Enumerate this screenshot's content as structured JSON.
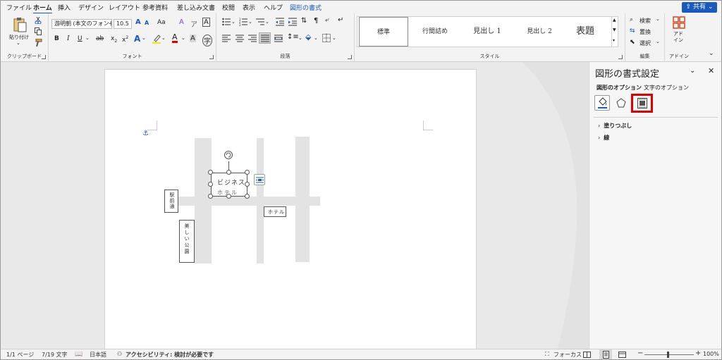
{
  "menu": {
    "tabs": [
      "ファイル",
      "ホーム",
      "挿入",
      "デザイン",
      "レイアウト",
      "参考資料",
      "差し込み文書",
      "校閲",
      "表示",
      "ヘルプ",
      "図形の書式"
    ],
    "share_label": "共有"
  },
  "ribbon": {
    "clipboard": {
      "paste_label": "貼り付け",
      "group_label": "クリップボード"
    },
    "font": {
      "font_name": "游明朝 (本文のフォント",
      "font_size": "10.5",
      "aa_label": "Aa",
      "group_label": "フォント"
    },
    "paragraph": {
      "group_label": "段落"
    },
    "styles": {
      "items": [
        "標準",
        "行間詰め",
        "見出し 1",
        "見出し 2",
        "表題"
      ],
      "group_label": "スタイル"
    },
    "editing": {
      "find": "検索",
      "replace": "置換",
      "select": "選択",
      "group_label": "編集"
    },
    "addins": {
      "label": "アド\nイン",
      "group_label": "アドイン"
    }
  },
  "document": {
    "shape_selected_text": "ビジネス",
    "shape_selected_sub": "ホテル",
    "shape_right_text": "ホテル",
    "shape_left_top_text": "駅前通",
    "shape_left_bottom_text": "美しい公園"
  },
  "pane": {
    "title": "図形の書式設定",
    "tab_shape": "図形のオプション",
    "tab_text": "文字のオプション",
    "section_fill": "塗りつぶし",
    "section_line": "線"
  },
  "status": {
    "page": "1/1 ページ",
    "words": "7/19 文字",
    "language": "日本語",
    "accessibility": "アクセシビリティ: 検討が必要です",
    "focus": "フォーカス",
    "zoom": "100%"
  },
  "colors": {
    "accent": "#185abd",
    "highlight_box": "#e00000"
  }
}
